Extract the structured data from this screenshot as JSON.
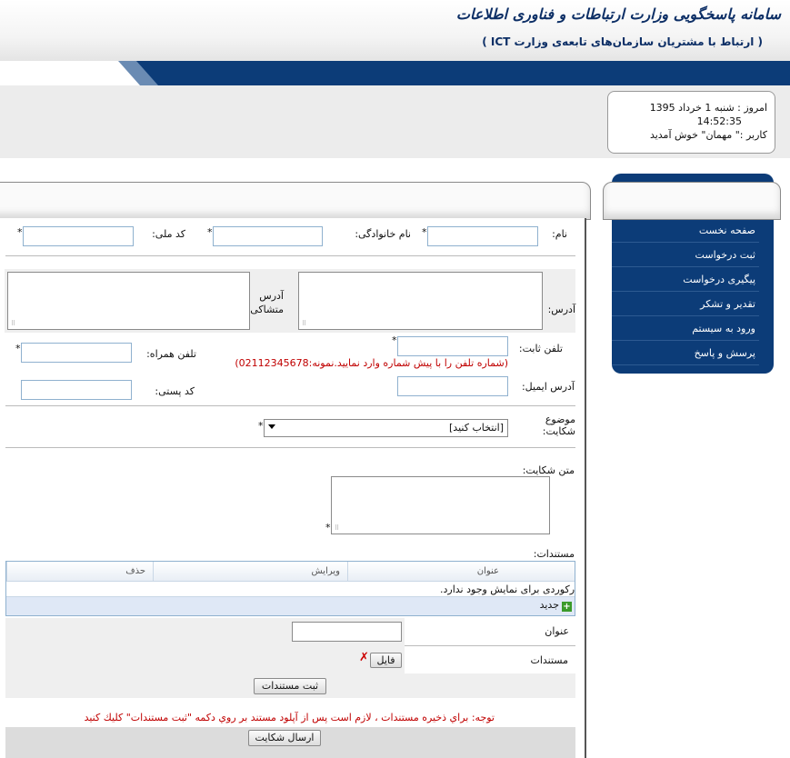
{
  "header": {
    "site_title": "سامانه پاسخگویی وزارت ارتباطات و فناوری اطلاعات",
    "site_subtitle": "( ارتباط با مشتریان سازمان‌های تابعه‌ی وزارت ICT )"
  },
  "info": {
    "date_line": "امروز : شنبه 1 خرداد 1395",
    "time_line": "14:52:35",
    "user_line": "کاربر :\" مهمان\" خوش آمدید"
  },
  "menu": {
    "items": [
      {
        "label": "صفحه نخست"
      },
      {
        "label": "ثبت درخواست"
      },
      {
        "label": "پیگیری درخواست"
      },
      {
        "label": "تقدیر و تشکر"
      },
      {
        "label": "ورود به سیستم"
      },
      {
        "label": "پرسش و پاسخ"
      }
    ]
  },
  "form": {
    "name_label": "نام:",
    "family_label": "نام خانوادگی:",
    "national_id_label": "کد ملی:",
    "address_label": "آدرس:",
    "origin_address_label": "آدرس متشاکی:",
    "phone_label": "تلفن ثابت:",
    "mobile_label": "تلفن همراه:",
    "phone_hint": "(شماره تلفن را با پیش شماره وارد نمایید.نمونه:02112345678)",
    "email_label": "آدرس ایمیل:",
    "postal_label": "کد پستی:",
    "subject_label": "موضوع شکایت:",
    "subject_value": "[انتخاب کنید]",
    "complaint_text_label": "متن شکایت:",
    "documents_label": "مستندات:",
    "required_mark": "*"
  },
  "documents_grid": {
    "columns": [
      "عنوان",
      "ویرایش",
      "حذف"
    ],
    "empty_text": "رکوردی برای نمایش وجود ندارد.",
    "add_label": "جدید"
  },
  "upload": {
    "title_label": "عنوان",
    "documents_label": "مستندات",
    "file_button": "فایل",
    "save_button": "ثبت مستندات",
    "note": "توجه: براي ذخيره مستندات ، لازم است پس از آپلود مستند بر روي دكمه \"ثبت مستندات\" كليك كنيد"
  },
  "submit": {
    "label": "ارسال شکایت"
  }
}
